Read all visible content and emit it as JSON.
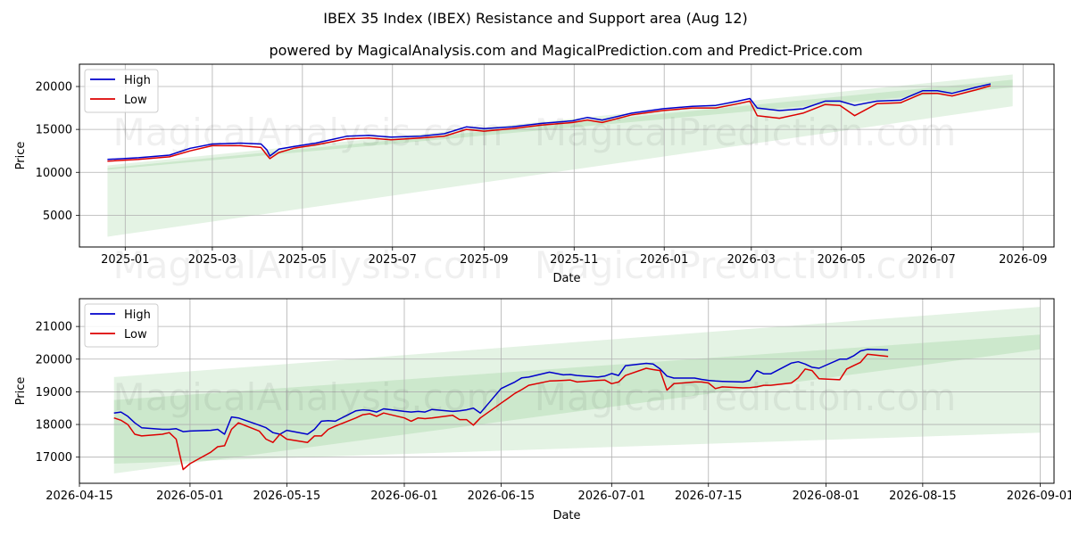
{
  "title": "IBEX 35 Index (IBEX) Resistance and Support area (Aug 12)",
  "subtitle": "powered by MagicalAnalysis.com and MagicalPrediction.com and Predict-Price.com",
  "watermarks": [
    "MagicalAnalysis.com",
    "MagicalPrediction.com"
  ],
  "colors": {
    "high": "#0000cc",
    "low": "#dd0000",
    "band": "#2ca02c",
    "grid": "#b0b0b0"
  },
  "chart_data": [
    {
      "type": "line",
      "xlabel": "Date",
      "ylabel": "Price",
      "xlim": [
        "2024-12-01",
        "2026-09-22"
      ],
      "ylim": [
        1300,
        22600
      ],
      "xticks": [
        "2025-01",
        "2025-03",
        "2025-05",
        "2025-07",
        "2025-09",
        "2025-11",
        "2026-01",
        "2026-03",
        "2026-05",
        "2026-07",
        "2026-09"
      ],
      "xtick_dates": [
        "2025-01-01",
        "2025-03-01",
        "2025-05-01",
        "2025-07-01",
        "2025-09-01",
        "2025-11-01",
        "2026-01-01",
        "2026-03-01",
        "2026-05-01",
        "2026-07-01",
        "2026-09-01"
      ],
      "yticks": [
        5000,
        10000,
        15000,
        20000
      ],
      "ytick_labels": [
        "5000",
        "10000",
        "15000",
        "20000"
      ],
      "grid": true,
      "legend": "top-left",
      "series": [
        {
          "name": "High",
          "color": "#0000cc",
          "x": [
            "2024-12-20",
            "2025-01-10",
            "2025-01-31",
            "2025-02-14",
            "2025-03-01",
            "2025-03-20",
            "2025-04-03",
            "2025-04-07",
            "2025-04-09",
            "2025-04-15",
            "2025-04-25",
            "2025-05-10",
            "2025-05-31",
            "2025-06-15",
            "2025-06-30",
            "2025-07-20",
            "2025-08-05",
            "2025-08-20",
            "2025-09-01",
            "2025-09-20",
            "2025-10-10",
            "2025-10-31",
            "2025-11-10",
            "2025-11-20",
            "2025-12-10",
            "2025-12-31",
            "2026-01-20",
            "2026-02-05",
            "2026-02-20",
            "2026-02-28",
            "2026-03-05",
            "2026-03-20",
            "2026-04-05",
            "2026-04-20",
            "2026-04-30",
            "2026-05-10",
            "2026-05-25",
            "2026-06-10",
            "2026-06-25",
            "2026-07-05",
            "2026-07-15",
            "2026-07-31",
            "2026-08-10"
          ],
          "values": [
            11500,
            11700,
            12000,
            12800,
            13300,
            13400,
            13300,
            12600,
            11900,
            12700,
            13000,
            13400,
            14200,
            14300,
            14100,
            14200,
            14500,
            15300,
            15100,
            15300,
            15700,
            16000,
            16400,
            16100,
            16900,
            17400,
            17700,
            17800,
            18300,
            18600,
            17500,
            17200,
            17400,
            18300,
            18300,
            17800,
            18300,
            18400,
            19500,
            19500,
            19200,
            19900,
            20300
          ]
        },
        {
          "name": "Low",
          "color": "#dd0000",
          "x": [
            "2024-12-20",
            "2025-01-10",
            "2025-01-31",
            "2025-02-14",
            "2025-03-01",
            "2025-03-20",
            "2025-04-03",
            "2025-04-07",
            "2025-04-09",
            "2025-04-15",
            "2025-04-25",
            "2025-05-10",
            "2025-05-31",
            "2025-06-15",
            "2025-06-30",
            "2025-07-20",
            "2025-08-05",
            "2025-08-20",
            "2025-09-01",
            "2025-09-20",
            "2025-10-10",
            "2025-10-31",
            "2025-11-10",
            "2025-11-20",
            "2025-12-10",
            "2025-12-31",
            "2026-01-20",
            "2026-02-05",
            "2026-02-20",
            "2026-02-28",
            "2026-03-05",
            "2026-03-20",
            "2026-04-05",
            "2026-04-20",
            "2026-04-30",
            "2026-05-10",
            "2026-05-25",
            "2026-06-10",
            "2026-06-25",
            "2026-07-05",
            "2026-07-15",
            "2026-07-31",
            "2026-08-10"
          ],
          "values": [
            11300,
            11500,
            11800,
            12500,
            13100,
            13100,
            12900,
            12000,
            11600,
            12300,
            12800,
            13200,
            13900,
            14000,
            13800,
            14000,
            14200,
            15000,
            14800,
            15100,
            15500,
            15800,
            16100,
            15800,
            16700,
            17200,
            17500,
            17500,
            18000,
            18300,
            16600,
            16300,
            16900,
            17900,
            17800,
            16600,
            18000,
            18100,
            19200,
            19200,
            18900,
            19600,
            20100
          ]
        }
      ],
      "bands": [
        {
          "name": "outer",
          "x": [
            "2024-12-20",
            "2026-08-25"
          ],
          "upper": [
            10800,
            21400
          ],
          "lower": [
            2500,
            17700
          ]
        },
        {
          "name": "inner",
          "x": [
            "2024-12-20",
            "2026-08-25"
          ],
          "upper": [
            10500,
            20800
          ],
          "lower": [
            10300,
            19900
          ]
        }
      ]
    },
    {
      "type": "line",
      "xlabel": "Date",
      "ylabel": "Price",
      "xlim": [
        "2026-04-15",
        "2026-09-03"
      ],
      "ylim": [
        16200,
        21850
      ],
      "xticks": [
        "2026-04-15",
        "2026-05-01",
        "2026-05-15",
        "2026-06-01",
        "2026-06-15",
        "2026-07-01",
        "2026-07-15",
        "2026-08-01",
        "2026-08-15",
        "2026-09-01"
      ],
      "yticks": [
        17000,
        18000,
        19000,
        20000,
        21000
      ],
      "ytick_labels": [
        "17000",
        "18000",
        "19000",
        "20000",
        "21000"
      ],
      "grid": true,
      "legend": "top-left",
      "series": [
        {
          "name": "High",
          "color": "#0000cc",
          "x": [
            "2026-04-20",
            "2026-04-21",
            "2026-04-22",
            "2026-04-23",
            "2026-04-24",
            "2026-04-27",
            "2026-04-28",
            "2026-04-29",
            "2026-04-30",
            "2026-05-01",
            "2026-05-04",
            "2026-05-05",
            "2026-05-06",
            "2026-05-07",
            "2026-05-08",
            "2026-05-11",
            "2026-05-12",
            "2026-05-13",
            "2026-05-14",
            "2026-05-15",
            "2026-05-18",
            "2026-05-19",
            "2026-05-20",
            "2026-05-21",
            "2026-05-22",
            "2026-05-25",
            "2026-05-26",
            "2026-05-27",
            "2026-05-28",
            "2026-05-29",
            "2026-06-01",
            "2026-06-02",
            "2026-06-03",
            "2026-06-04",
            "2026-06-05",
            "2026-06-08",
            "2026-06-09",
            "2026-06-10",
            "2026-06-11",
            "2026-06-12",
            "2026-06-15",
            "2026-06-16",
            "2026-06-17",
            "2026-06-18",
            "2026-06-19",
            "2026-06-22",
            "2026-06-23",
            "2026-06-24",
            "2026-06-25",
            "2026-06-26",
            "2026-06-29",
            "2026-06-30",
            "2026-07-01",
            "2026-07-02",
            "2026-07-03",
            "2026-07-06",
            "2026-07-07",
            "2026-07-08",
            "2026-07-09",
            "2026-07-10",
            "2026-07-13",
            "2026-07-14",
            "2026-07-15",
            "2026-07-16",
            "2026-07-17",
            "2026-07-20",
            "2026-07-21",
            "2026-07-22",
            "2026-07-23",
            "2026-07-24",
            "2026-07-27",
            "2026-07-28",
            "2026-07-29",
            "2026-07-30",
            "2026-07-31",
            "2026-08-03",
            "2026-08-04",
            "2026-08-05",
            "2026-08-06",
            "2026-08-07",
            "2026-08-10"
          ],
          "values": [
            18350,
            18380,
            18250,
            18050,
            17900,
            17850,
            17850,
            17870,
            17780,
            17800,
            17820,
            17850,
            17700,
            18230,
            18200,
            17980,
            17900,
            17750,
            17700,
            17820,
            17700,
            17850,
            18100,
            18120,
            18100,
            18420,
            18450,
            18430,
            18380,
            18480,
            18400,
            18380,
            18400,
            18380,
            18460,
            18400,
            18420,
            18450,
            18500,
            18350,
            19100,
            19200,
            19300,
            19430,
            19450,
            19600,
            19560,
            19520,
            19530,
            19500,
            19450,
            19480,
            19560,
            19500,
            19800,
            19870,
            19850,
            19700,
            19480,
            19420,
            19420,
            19380,
            19350,
            19330,
            19320,
            19300,
            19350,
            19650,
            19550,
            19550,
            19880,
            19920,
            19850,
            19750,
            19720,
            20000,
            20000,
            20100,
            20250,
            20300,
            20280
          ],
          "xs_hint": "computed"
        },
        {
          "name": "Low",
          "color": "#dd0000",
          "x": [
            "2026-04-20",
            "2026-04-21",
            "2026-04-22",
            "2026-04-23",
            "2026-04-24",
            "2026-04-27",
            "2026-04-28",
            "2026-04-29",
            "2026-04-30",
            "2026-05-01",
            "2026-05-04",
            "2026-05-05",
            "2026-05-06",
            "2026-05-07",
            "2026-05-08",
            "2026-05-11",
            "2026-05-12",
            "2026-05-13",
            "2026-05-14",
            "2026-05-15",
            "2026-05-18",
            "2026-05-19",
            "2026-05-20",
            "2026-05-21",
            "2026-05-22",
            "2026-05-25",
            "2026-05-26",
            "2026-05-27",
            "2026-05-28",
            "2026-05-29",
            "2026-06-01",
            "2026-06-02",
            "2026-06-03",
            "2026-06-04",
            "2026-06-05",
            "2026-06-08",
            "2026-06-09",
            "2026-06-10",
            "2026-06-11",
            "2026-06-12",
            "2026-06-15",
            "2026-06-16",
            "2026-06-17",
            "2026-06-18",
            "2026-06-19",
            "2026-06-22",
            "2026-06-23",
            "2026-06-24",
            "2026-06-25",
            "2026-06-26",
            "2026-06-29",
            "2026-06-30",
            "2026-07-01",
            "2026-07-02",
            "2026-07-03",
            "2026-07-06",
            "2026-07-07",
            "2026-07-08",
            "2026-07-09",
            "2026-07-10",
            "2026-07-13",
            "2026-07-14",
            "2026-07-15",
            "2026-07-16",
            "2026-07-17",
            "2026-07-20",
            "2026-07-21",
            "2026-07-22",
            "2026-07-23",
            "2026-07-24",
            "2026-07-27",
            "2026-07-28",
            "2026-07-29",
            "2026-07-30",
            "2026-07-31",
            "2026-08-03",
            "2026-08-04",
            "2026-08-05",
            "2026-08-06",
            "2026-08-07",
            "2026-08-10"
          ],
          "values": [
            18200,
            18130,
            18000,
            17700,
            17650,
            17700,
            17750,
            17550,
            16620,
            16800,
            17150,
            17320,
            17350,
            17850,
            18050,
            17800,
            17550,
            17450,
            17700,
            17550,
            17450,
            17650,
            17650,
            17850,
            17950,
            18200,
            18300,
            18330,
            18250,
            18350,
            18200,
            18100,
            18200,
            18180,
            18200,
            18280,
            18150,
            18150,
            17980,
            18200,
            18650,
            18800,
            18950,
            19070,
            19200,
            19330,
            19340,
            19350,
            19360,
            19300,
            19350,
            19360,
            19250,
            19300,
            19500,
            19720,
            19680,
            19650,
            19050,
            19250,
            19300,
            19300,
            19270,
            19100,
            19150,
            19120,
            19130,
            19150,
            19200,
            19200,
            19270,
            19430,
            19700,
            19650,
            19400,
            19370,
            19700,
            19800,
            19900,
            20150,
            20080
          ],
          "xs_hint": "computed"
        }
      ],
      "bands": [
        {
          "name": "outer",
          "x": [
            "2026-04-20",
            "2026-09-01"
          ],
          "upper": [
            19450,
            21600
          ],
          "lower": [
            16800,
            17750
          ]
        },
        {
          "name": "inner",
          "x": [
            "2026-04-20",
            "2026-09-01"
          ],
          "upper": [
            18750,
            20750
          ],
          "lower": [
            16500,
            20300
          ]
        }
      ]
    }
  ],
  "legend_labels": {
    "high": "High",
    "low": "Low"
  }
}
